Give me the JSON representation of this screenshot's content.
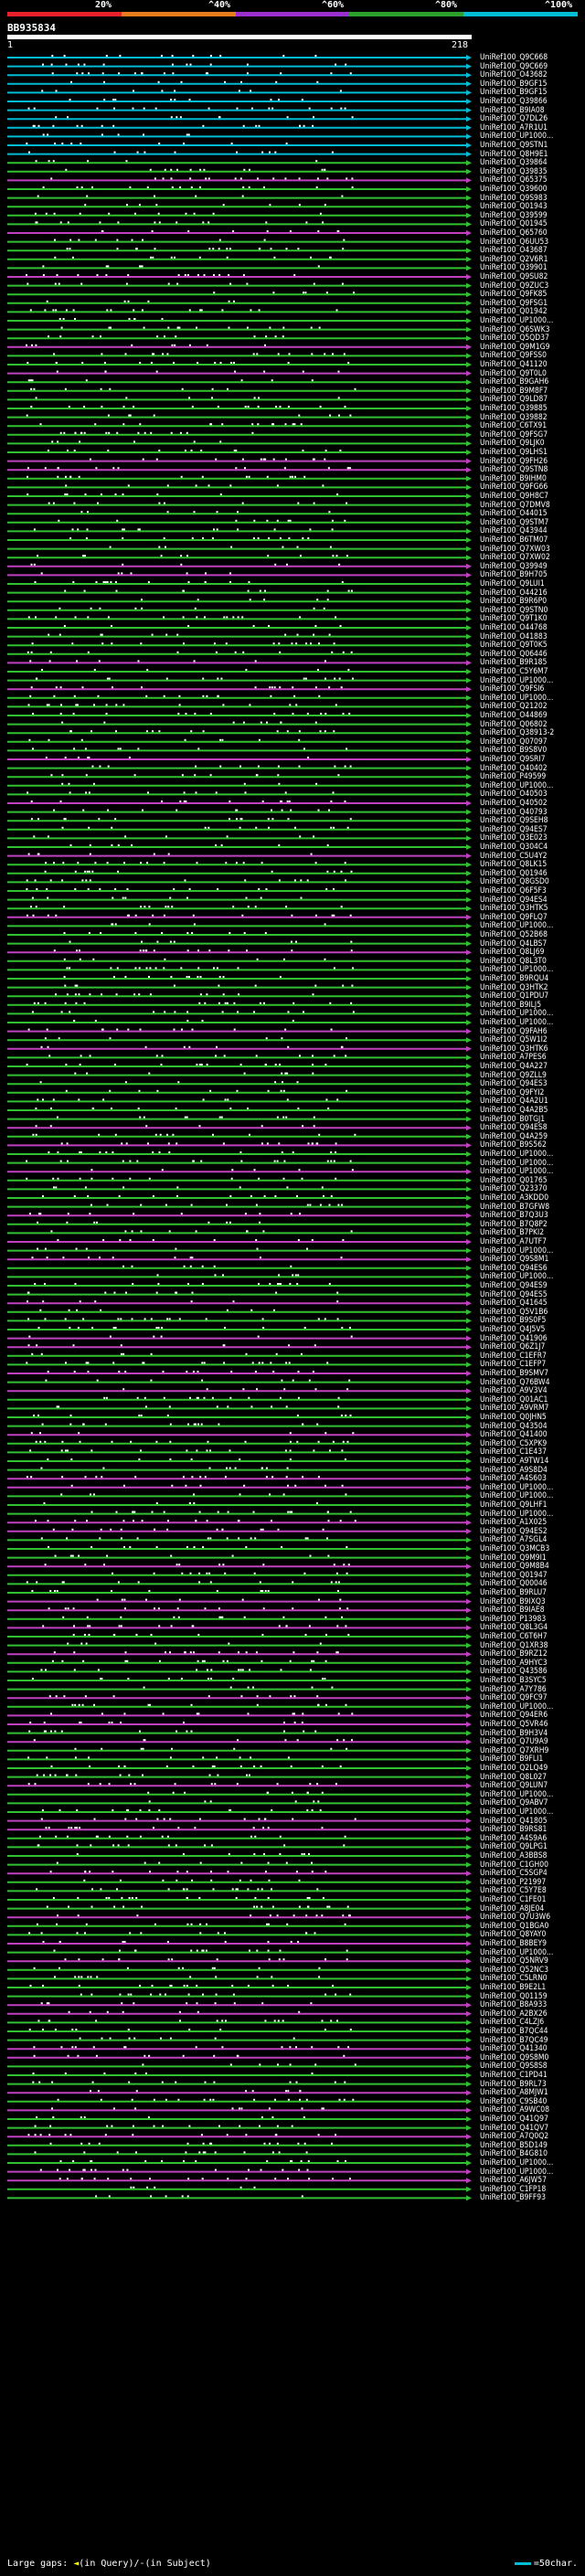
{
  "scale": {
    "labels": [
      "20%",
      "^40%",
      "^60%",
      "^80%",
      "^100%"
    ],
    "colors": [
      "#e8202a",
      "#e87d1e",
      "#9b30d0",
      "#2ca02c",
      "#00bcd4"
    ]
  },
  "query": {
    "name": "BB935834",
    "start": "1",
    "end": "218"
  },
  "legend": {
    "gaps_label": "Large gaps: ",
    "gaps_detail": "(in Query)/-(in Subject)",
    "scale_label": "=50char."
  },
  "colors": {
    "identity_40_60": "#c040c0",
    "identity_60_80": "#30c030",
    "identity_80_100": "#00bcd4",
    "background": "#000000"
  },
  "hits": [
    "UniRef100_Q9C668",
    "UniRef100_Q9C669",
    "UniRef100_O43682",
    "UniRef100_B9GF15",
    "UniRef100_B9GF15",
    "UniRef100_Q39866",
    "UniRef100_B9IA08",
    "UniRef100_Q7DL26",
    "UniRef100_A7R1U1",
    "UniRef100_UP1000...",
    "UniRef100_Q9STN1",
    "UniRef100_Q8H9E1",
    "UniRef100_Q39864",
    "UniRef100_Q39835",
    "UniRef100_Q65375",
    "UniRef100_Q39600",
    "UniRef100_Q9S983",
    "UniRef100_Q01943",
    "UniRef100_Q39599",
    "UniRef100_Q01945",
    "UniRef100_Q65760",
    "UniRef100_Q6UU53",
    "UniRef100_O43687",
    "UniRef100_Q2V6R1",
    "UniRef100_Q39901",
    "UniRef100_Q9SU82",
    "UniRef100_Q9ZUC3",
    "UniRef100_Q9FK85",
    "UniRef100_Q9FSG1",
    "UniRef100_Q01942",
    "UniRef100_UP1000...",
    "UniRef100_Q6SWK3",
    "UniRef100_Q5QD37",
    "UniRef100_Q9M1G9",
    "UniRef100_Q9FSS0",
    "UniRef100_Q41120",
    "UniRef100_Q9T0L0",
    "UniRef100_B9GAH6",
    "UniRef100_B9M8F7",
    "UniRef100_Q9LD87",
    "UniRef100_Q39885",
    "UniRef100_Q39882",
    "UniRef100_C6TX91",
    "UniRef100_Q9FSG7",
    "UniRef100_Q9LJK0",
    "UniRef100_Q9LHS1",
    "UniRef100_Q9FH26",
    "UniRef100_Q9STN8",
    "UniRef100_B9IHM0",
    "UniRef100_Q9FG66",
    "UniRef100_Q9H8C7",
    "UniRef100_Q7DMV8",
    "UniRef100_O44015",
    "UniRef100_Q9STM7",
    "UniRef100_Q43944",
    "UniRef100_B6TM07",
    "UniRef100_Q7XW03",
    "UniRef100_Q7XW02",
    "UniRef100_Q39949",
    "UniRef100_B9H705",
    "UniRef100_Q9LUI1",
    "UniRef100_O44216",
    "UniRef100_B9R6P0",
    "UniRef100_Q9STN0",
    "UniRef100_Q9T1K0",
    "UniRef100_O44768",
    "UniRef100_O41883",
    "UniRef100_Q9T0K5",
    "UniRef100_Q06446",
    "UniRef100_B9R185",
    "UniRef100_C5Y6M7",
    "UniRef100_UP1000...",
    "UniRef100_Q9FSI6",
    "UniRef100_UP1000...",
    "UniRef100_Q21202",
    "UniRef100_O44869",
    "UniRef100_Q06802",
    "UniRef100_Q38913-2",
    "UniRef100_Q07097",
    "UniRef100_B9S8V0",
    "UniRef100_Q9SRI7",
    "UniRef100_Q40402",
    "UniRef100_P49599",
    "UniRef100_UP1000...",
    "UniRef100_O40503",
    "UniRef100_Q40502",
    "UniRef100_Q40793",
    "UniRef100_Q9SEH8",
    "UniRef100_Q94ES7",
    "UniRef100_Q3E023",
    "UniRef100_Q304C4",
    "UniRef100_C5U4Y2",
    "UniRef100_Q8LK15",
    "UniRef100_Q01946",
    "UniRef100_Q8GSD0",
    "UniRef100_Q6F5F3",
    "UniRef100_Q94ES4",
    "UniRef100_Q3HTK5",
    "UniRef100_Q9FLQ7",
    "UniRef100_UP1000...",
    "UniRef100_Q52B68",
    "UniRef100_Q4LBS7",
    "UniRef100_Q8LJ69",
    "UniRef100_Q8L3T0",
    "UniRef100_UP1000...",
    "UniRef100_B9RQU4",
    "UniRef100_Q3HTK2",
    "UniRef100_Q1PDU7",
    "UniRef100_B9ILJ5",
    "UniRef100_UP1000...",
    "UniRef100_UP1000...",
    "UniRef100_Q9FAH6",
    "UniRef100_Q5W1I2",
    "UniRef100_Q3HTK6",
    "UniRef100_A7PES6",
    "UniRef100_Q4A227",
    "UniRef100_Q9ZLL9",
    "UniRef100_Q94ES3",
    "UniRef100_Q9FYI2",
    "UniRef100_Q4A2U1",
    "UniRef100_Q4A2B5",
    "UniRef100_B0TGJ1",
    "UniRef100_Q94ES8",
    "UniRef100_Q4A259",
    "UniRef100_B9S562",
    "UniRef100_UP1000...",
    "UniRef100_UP1000...",
    "UniRef100_UP1000...",
    "UniRef100_Q01765",
    "UniRef100_Q23370",
    "UniRef100_A3KDD0",
    "UniRef100_B7GFW8",
    "UniRef100_B7Q3U3",
    "UniRef100_B7Q8P2",
    "UniRef100_B7PKI2",
    "UniRef100_A7UTF7",
    "UniRef100_UP1000...",
    "UniRef100_Q9S8M1",
    "UniRef100_Q94ES6",
    "UniRef100_UP1000...",
    "UniRef100_Q94ES9",
    "UniRef100_Q94ES5",
    "UniRef100_Q41645",
    "UniRef100_Q5V1B6",
    "UniRef100_B9S0F5",
    "UniRef100_Q4J5V5",
    "UniRef100_Q41906",
    "UniRef100_Q6Z1J7",
    "UniRef100_C1EFR7",
    "UniRef100_C1EFP7",
    "UniRef100_B9SMV7",
    "UniRef100_Q76BW4",
    "UniRef100_A9V3V4",
    "UniRef100_Q01AC1",
    "UniRef100_A9VRM7",
    "UniRef100_Q0JHN5",
    "UniRef100_Q43504",
    "UniRef100_Q41400",
    "UniRef100_C5XPK9",
    "UniRef100_C1E437",
    "UniRef100_A9TW14",
    "UniRef100_A9S8D4",
    "UniRef100_A4S603",
    "UniRef100_UP1000...",
    "UniRef100_UP1000...",
    "UniRef100_Q9LHF1",
    "UniRef100_UP1000...",
    "UniRef100_A1X025",
    "UniRef100_Q94ES2",
    "UniRef100_A7SGL4",
    "UniRef100_Q3MCB3",
    "UniRef100_Q9M9I1",
    "UniRef100_Q9M8B4",
    "UniRef100_Q01947",
    "UniRef100_Q00046",
    "UniRef100_B9RLU7",
    "UniRef100_B9IXQ3",
    "UniRef100_B9IAE8",
    "UniRef100_P13983",
    "UniRef100_Q8L3G4",
    "UniRef100_C6T6H7",
    "UniRef100_Q1XR38",
    "UniRef100_B9RZ12",
    "UniRef100_A9HYC3",
    "UniRef100_Q43586",
    "UniRef100_B3SYC5",
    "UniRef100_A7Y786",
    "UniRef100_Q9FC97",
    "UniRef100_UP1000...",
    "UniRef100_Q94ER6",
    "UniRef100_Q5VR46",
    "UniRef100_B9H3V4",
    "UniRef100_Q7U9A9",
    "UniRef100_Q7XRH9",
    "UniRef100_B9FLI1",
    "UniRef100_Q2LQ49",
    "UniRef100_Q8L027",
    "UniRef100_Q9LUN7",
    "UniRef100_UP1000...",
    "UniRef100_Q9ABV7",
    "UniRef100_UP1000...",
    "UniRef100_Q41805",
    "UniRef100_B9RS81",
    "UniRef100_A4S9A6",
    "UniRef100_Q9LPG1",
    "UniRef100_A3BBS8",
    "UniRef100_C1GH00",
    "UniRef100_C5SGP4",
    "UniRef100_P21997",
    "UniRef100_C5Y7E8",
    "UniRef100_C1FE01",
    "UniRef100_A8JE04",
    "UniRef100_Q7U3W6",
    "UniRef100_Q1BGA0",
    "UniRef100_Q8YAY0",
    "UniRef100_B8BEY9",
    "UniRef100_UP1000...",
    "UniRef100_Q5NRV9",
    "UniRef100_Q52NC3",
    "UniRef100_C5LRN0",
    "UniRef100_B9E2L1",
    "UniRef100_Q01159",
    "UniRef100_B8A933",
    "UniRef100_A2BX26",
    "UniRef100_C4LZJ6",
    "UniRef100_B7QC44",
    "UniRef100_B7QC49",
    "UniRef100_Q41340",
    "UniRef100_Q9S8M0",
    "UniRef100_Q9S8S8",
    "UniRef100_C1PD41",
    "UniRef100_B9RL73",
    "UniRef100_A8MJW1",
    "UniRef100_C9SB40",
    "UniRef100_A9WC08",
    "UniRef100_Q41Q97",
    "UniRef100_Q41QV7",
    "UniRef100_A7Q0Q2",
    "UniRef100_B5D149",
    "UniRef100_B4G810",
    "UniRef100_UP1000...",
    "UniRef100_UP1000...",
    "UniRef100_A6JW57",
    "UniRef100_C1FP18",
    "UniRef100_B9FF93"
  ]
}
